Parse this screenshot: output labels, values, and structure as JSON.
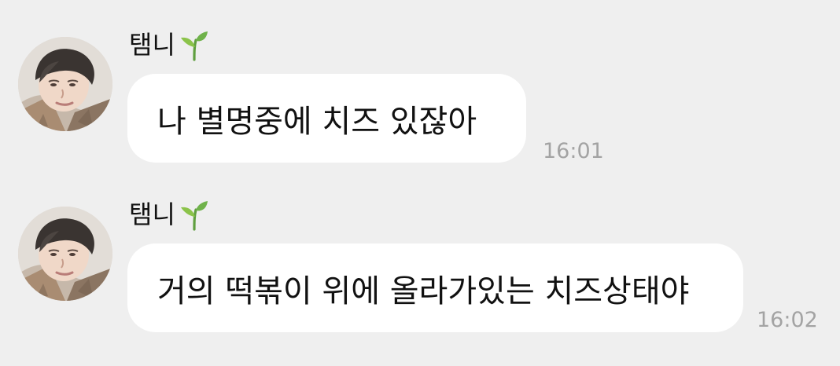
{
  "messages": [
    {
      "sender": "탬니",
      "sender_icon": "sprout-icon",
      "text": "나 별명중에 치즈 있잖아",
      "time": "16:01"
    },
    {
      "sender": "탬니",
      "sender_icon": "sprout-icon",
      "text": "거의 떡볶이 위에 올라가있는 치즈상태야",
      "time": "16:02"
    }
  ],
  "colors": {
    "background": "#efefef",
    "bubble": "#ffffff",
    "timestamp": "#a3a3a3",
    "text": "#111111",
    "sprout_green": "#6fb24a"
  }
}
